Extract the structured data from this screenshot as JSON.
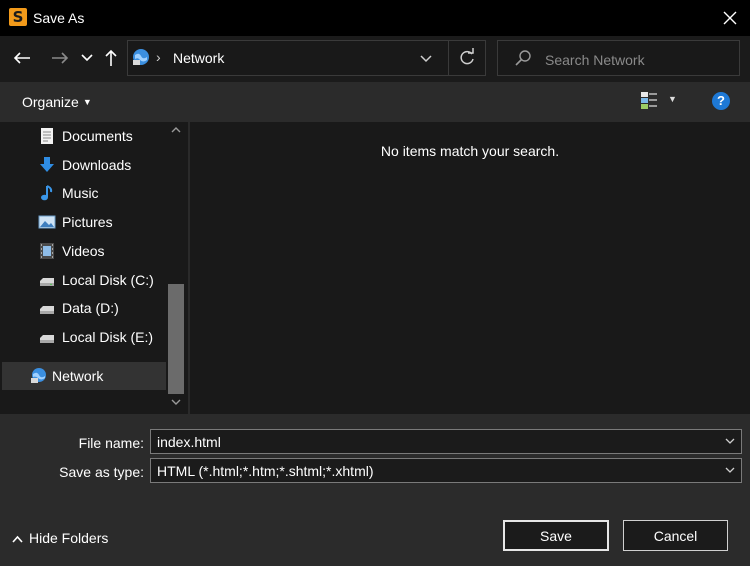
{
  "window": {
    "title": "Save As"
  },
  "address": {
    "location": "Network"
  },
  "search": {
    "placeholder": "Search Network"
  },
  "toolbar": {
    "organize_label": "Organize"
  },
  "sidebar": {
    "items": [
      {
        "label": "Documents",
        "icon": "documents-icon"
      },
      {
        "label": "Downloads",
        "icon": "downloads-icon"
      },
      {
        "label": "Music",
        "icon": "music-icon"
      },
      {
        "label": "Pictures",
        "icon": "pictures-icon"
      },
      {
        "label": "Videos",
        "icon": "videos-icon"
      },
      {
        "label": "Local Disk (C:)",
        "icon": "drive-icon"
      },
      {
        "label": "Data (D:)",
        "icon": "drive-icon"
      },
      {
        "label": "Local Disk (E:)",
        "icon": "drive-icon"
      },
      {
        "label": "Network",
        "icon": "network-icon",
        "selected": true
      }
    ]
  },
  "main": {
    "empty_message": "No items match your search."
  },
  "form": {
    "filename_label": "File name:",
    "filename_value": "index.html",
    "type_label": "Save as type:",
    "type_value": "HTML (*.html;*.htm;*.shtml;*.xhtml)"
  },
  "footer": {
    "hide_folders_label": "Hide Folders",
    "save_label": "Save",
    "cancel_label": "Cancel"
  },
  "colors": {
    "accent": "#1e79d6",
    "app_icon": "#f29a1a"
  }
}
